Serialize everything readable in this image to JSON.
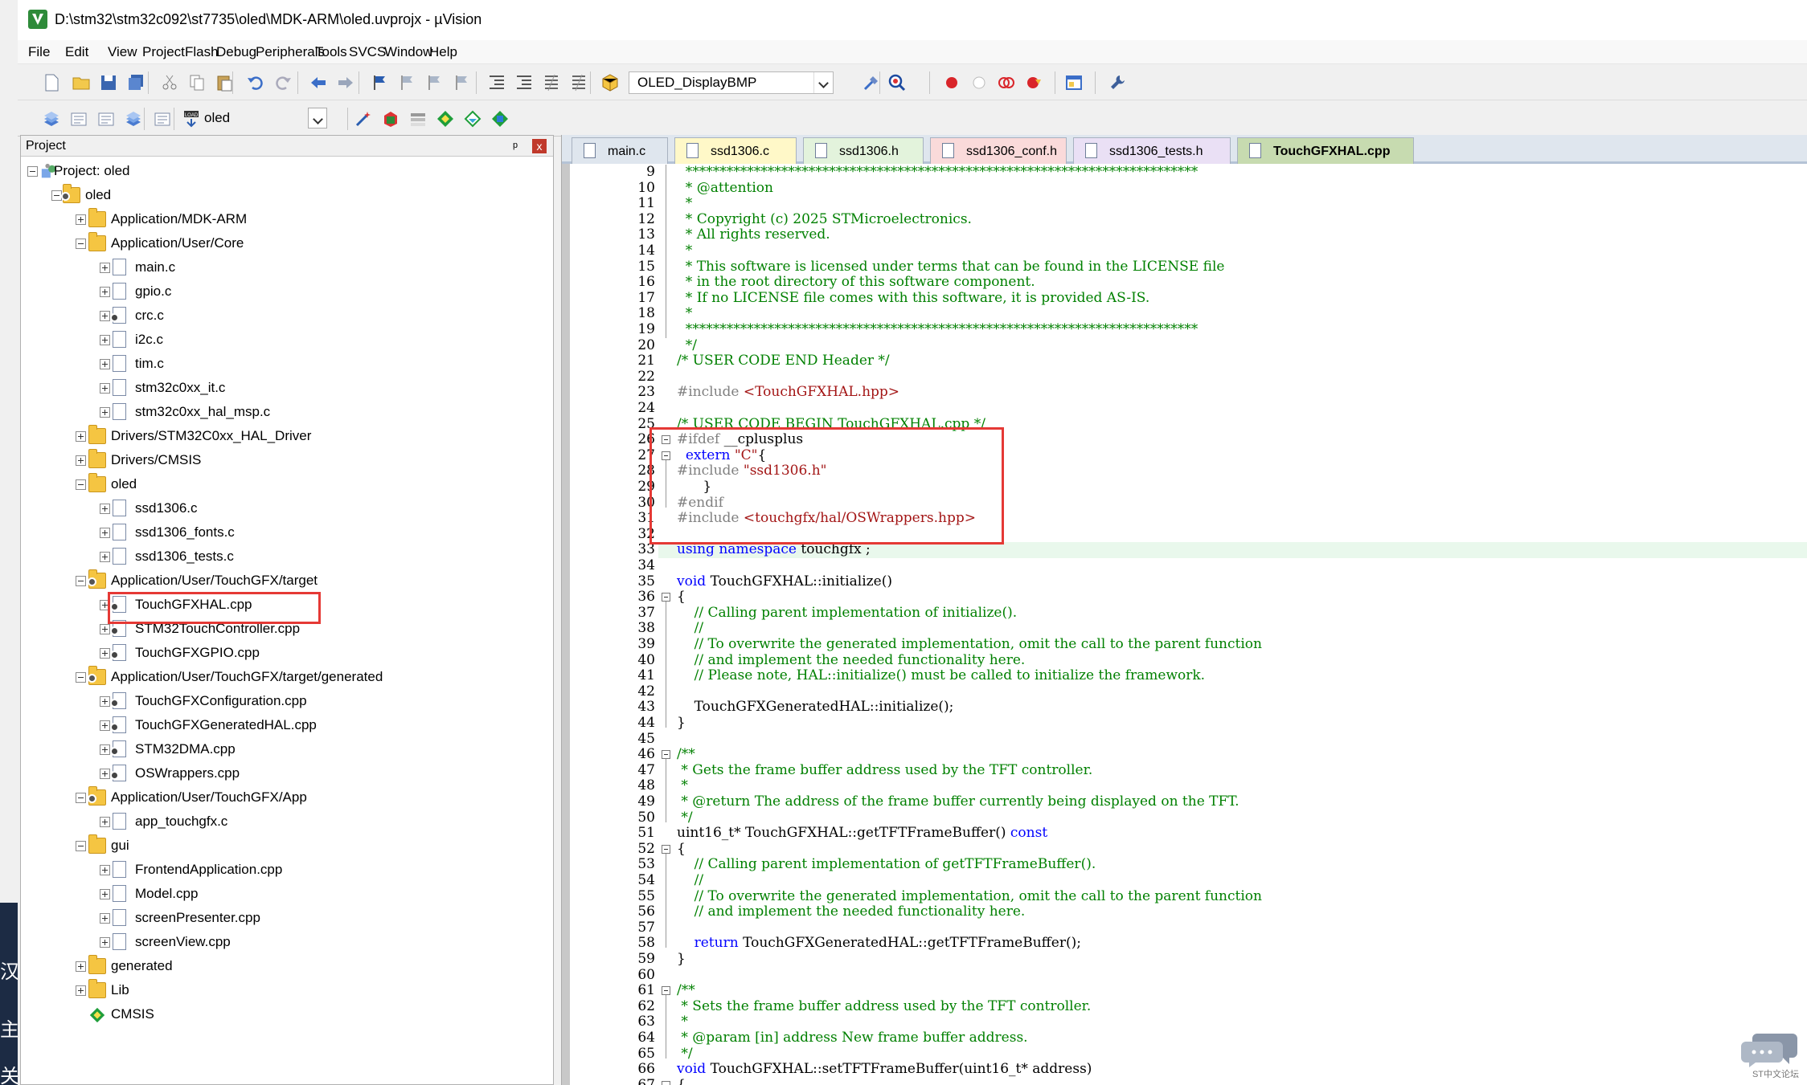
{
  "window": {
    "title": "D:\\stm32\\stm32c092\\st7735\\oled\\MDK-ARM\\oled.uvprojx - µVision"
  },
  "menu": [
    "File",
    "Edit",
    "View",
    "Project",
    "Flash",
    "Debug",
    "Peripherals",
    "Tools",
    "SVCS",
    "Window",
    "Help"
  ],
  "toolbar": {
    "target_combo": "OLED_DisplayBMP",
    "build_target": "oled"
  },
  "project": {
    "header": "Project",
    "pin": "ᵖ",
    "close": "x",
    "tree": [
      {
        "level": 0,
        "label": "Project: oled",
        "exp": "minus",
        "icon": "project"
      },
      {
        "level": 1,
        "label": "oled",
        "exp": "minus",
        "icon": "target"
      },
      {
        "level": 2,
        "label": "Application/MDK-ARM",
        "exp": "plus",
        "icon": "folder"
      },
      {
        "level": 2,
        "label": "Application/User/Core",
        "exp": "minus",
        "icon": "folder-open"
      },
      {
        "level": 3,
        "label": "main.c",
        "exp": "plus",
        "icon": "file"
      },
      {
        "level": 3,
        "label": "gpio.c",
        "exp": "plus",
        "icon": "file"
      },
      {
        "level": 3,
        "label": "crc.c",
        "exp": "plus",
        "icon": "file-gear"
      },
      {
        "level": 3,
        "label": "i2c.c",
        "exp": "plus",
        "icon": "file"
      },
      {
        "level": 3,
        "label": "tim.c",
        "exp": "plus",
        "icon": "file"
      },
      {
        "level": 3,
        "label": "stm32c0xx_it.c",
        "exp": "plus",
        "icon": "file"
      },
      {
        "level": 3,
        "label": "stm32c0xx_hal_msp.c",
        "exp": "plus",
        "icon": "file"
      },
      {
        "level": 2,
        "label": "Drivers/STM32C0xx_HAL_Driver",
        "exp": "plus",
        "icon": "folder"
      },
      {
        "level": 2,
        "label": "Drivers/CMSIS",
        "exp": "plus",
        "icon": "folder"
      },
      {
        "level": 2,
        "label": "oled",
        "exp": "minus",
        "icon": "folder-open"
      },
      {
        "level": 3,
        "label": "ssd1306.c",
        "exp": "plus",
        "icon": "file"
      },
      {
        "level": 3,
        "label": "ssd1306_fonts.c",
        "exp": "plus",
        "icon": "file"
      },
      {
        "level": 3,
        "label": "ssd1306_tests.c",
        "exp": "plus",
        "icon": "file"
      },
      {
        "level": 2,
        "label": "Application/User/TouchGFX/target",
        "exp": "minus",
        "icon": "folder-gear"
      },
      {
        "level": 3,
        "label": "TouchGFXHAL.cpp",
        "exp": "plus",
        "icon": "file-gear"
      },
      {
        "level": 3,
        "label": "STM32TouchController.cpp",
        "exp": "plus",
        "icon": "file-gear"
      },
      {
        "level": 3,
        "label": "TouchGFXGPIO.cpp",
        "exp": "plus",
        "icon": "file-gear"
      },
      {
        "level": 2,
        "label": "Application/User/TouchGFX/target/generated",
        "exp": "minus",
        "icon": "folder-gear"
      },
      {
        "level": 3,
        "label": "TouchGFXConfiguration.cpp",
        "exp": "plus",
        "icon": "file-gear"
      },
      {
        "level": 3,
        "label": "TouchGFXGeneratedHAL.cpp",
        "exp": "plus",
        "icon": "file-gear"
      },
      {
        "level": 3,
        "label": "STM32DMA.cpp",
        "exp": "plus",
        "icon": "file-gear"
      },
      {
        "level": 3,
        "label": "OSWrappers.cpp",
        "exp": "plus",
        "icon": "file-gear"
      },
      {
        "level": 2,
        "label": "Application/User/TouchGFX/App",
        "exp": "minus",
        "icon": "folder-gear"
      },
      {
        "level": 3,
        "label": "app_touchgfx.c",
        "exp": "plus",
        "icon": "file"
      },
      {
        "level": 2,
        "label": "gui",
        "exp": "minus",
        "icon": "folder-open"
      },
      {
        "level": 3,
        "label": "FrontendApplication.cpp",
        "exp": "plus",
        "icon": "file"
      },
      {
        "level": 3,
        "label": "Model.cpp",
        "exp": "plus",
        "icon": "file"
      },
      {
        "level": 3,
        "label": "screenPresenter.cpp",
        "exp": "plus",
        "icon": "file"
      },
      {
        "level": 3,
        "label": "screenView.cpp",
        "exp": "plus",
        "icon": "file"
      },
      {
        "level": 2,
        "label": "generated",
        "exp": "plus",
        "icon": "folder"
      },
      {
        "level": 2,
        "label": "Lib",
        "exp": "plus",
        "icon": "folder"
      },
      {
        "level": 2,
        "label": "CMSIS",
        "exp": "none",
        "icon": "diamond"
      }
    ]
  },
  "tabs": [
    {
      "label": "main.c",
      "color": "#dfe6ee",
      "active": false
    },
    {
      "label": "ssd1306.c",
      "color": "#fff8c8",
      "active": false
    },
    {
      "label": "ssd1306.h",
      "color": "#e3f3dc",
      "active": false
    },
    {
      "label": "ssd1306_conf.h",
      "color": "#fadada",
      "active": false
    },
    {
      "label": "ssd1306_tests.h",
      "color": "#eae0f5",
      "active": false
    },
    {
      "label": "TouchGFXHAL.cpp",
      "color": "#c7dbb0",
      "active": true
    }
  ],
  "code": [
    {
      "n": "9",
      "t": [
        [
          "cm",
          "  ***************************************************************************"
        ]
      ]
    },
    {
      "n": "10",
      "t": [
        [
          "cm",
          "  * @attention"
        ]
      ]
    },
    {
      "n": "11",
      "t": [
        [
          "cm",
          "  *"
        ]
      ]
    },
    {
      "n": "12",
      "t": [
        [
          "cm",
          "  * Copyright (c) 2025 STMicroelectronics."
        ]
      ]
    },
    {
      "n": "13",
      "t": [
        [
          "cm",
          "  * All rights reserved."
        ]
      ]
    },
    {
      "n": "14",
      "t": [
        [
          "cm",
          "  *"
        ]
      ]
    },
    {
      "n": "15",
      "t": [
        [
          "cm",
          "  * This software is licensed under terms that can be found in the LICENSE file"
        ]
      ]
    },
    {
      "n": "16",
      "t": [
        [
          "cm",
          "  * in the root directory of this software component."
        ]
      ]
    },
    {
      "n": "17",
      "t": [
        [
          "cm",
          "  * If no LICENSE file comes with this software, it is provided AS-IS."
        ]
      ]
    },
    {
      "n": "18",
      "t": [
        [
          "cm",
          "  *"
        ]
      ]
    },
    {
      "n": "19",
      "t": [
        [
          "cm",
          "  ***************************************************************************"
        ]
      ]
    },
    {
      "n": "20",
      "t": [
        [
          "cm",
          "  */"
        ]
      ]
    },
    {
      "n": "21",
      "t": [
        [
          "cm",
          "/* USER CODE END Header */"
        ]
      ]
    },
    {
      "n": "22",
      "t": []
    },
    {
      "n": "23",
      "t": [
        [
          "pp",
          "#include "
        ],
        [
          "st",
          "<TouchGFXHAL.hpp>"
        ]
      ]
    },
    {
      "n": "24",
      "t": []
    },
    {
      "n": "25",
      "t": [
        [
          "cm",
          "/* USER CODE BEGIN TouchGFXHAL.cpp */"
        ]
      ]
    },
    {
      "n": "26",
      "t": [
        [
          "pp",
          "#ifdef "
        ],
        [
          "tx",
          "__cplusplus"
        ]
      ]
    },
    {
      "n": "27",
      "t": [
        [
          "tx",
          "  "
        ],
        [
          "kw",
          "extern"
        ],
        [
          "tx",
          " "
        ],
        [
          "st",
          "\"C\""
        ],
        [
          "tx",
          "{"
        ]
      ]
    },
    {
      "n": "28",
      "t": [
        [
          "pp",
          "#include "
        ],
        [
          "st",
          "\"ssd1306.h\""
        ]
      ]
    },
    {
      "n": "29",
      "t": [
        [
          "tx",
          "      }"
        ]
      ]
    },
    {
      "n": "30",
      "t": [
        [
          "pp",
          "#endif"
        ]
      ]
    },
    {
      "n": "31",
      "t": [
        [
          "pp",
          "#include "
        ],
        [
          "st",
          "<touchgfx/hal/OSWrappers.hpp>"
        ]
      ]
    },
    {
      "n": "32",
      "t": []
    },
    {
      "n": "33",
      "t": [
        [
          "kw",
          "using"
        ],
        [
          "tx",
          " "
        ],
        [
          "kw",
          "namespace"
        ],
        [
          "tx",
          " touchgfx ;"
        ]
      ]
    },
    {
      "n": "34",
      "t": []
    },
    {
      "n": "35",
      "t": [
        [
          "kw",
          "void"
        ],
        [
          "tx",
          " TouchGFXHAL::initialize()"
        ]
      ]
    },
    {
      "n": "36",
      "t": [
        [
          "tx",
          "{"
        ]
      ]
    },
    {
      "n": "37",
      "t": [
        [
          "cm",
          "    // Calling parent implementation of initialize()."
        ]
      ]
    },
    {
      "n": "38",
      "t": [
        [
          "cm",
          "    //"
        ]
      ]
    },
    {
      "n": "39",
      "t": [
        [
          "cm",
          "    // To overwrite the generated implementation, omit the call to the parent function"
        ]
      ]
    },
    {
      "n": "40",
      "t": [
        [
          "cm",
          "    // and implement the needed functionality here."
        ]
      ]
    },
    {
      "n": "41",
      "t": [
        [
          "cm",
          "    // Please note, HAL::initialize() must be called to initialize the framework."
        ]
      ]
    },
    {
      "n": "42",
      "t": []
    },
    {
      "n": "43",
      "t": [
        [
          "tx",
          "    TouchGFXGeneratedHAL::initialize();"
        ]
      ]
    },
    {
      "n": "44",
      "t": [
        [
          "tx",
          "}"
        ]
      ]
    },
    {
      "n": "45",
      "t": []
    },
    {
      "n": "46",
      "t": [
        [
          "cm",
          "/**"
        ]
      ]
    },
    {
      "n": "47",
      "t": [
        [
          "cm",
          " * Gets the frame buffer address used by the TFT controller."
        ]
      ]
    },
    {
      "n": "48",
      "t": [
        [
          "cm",
          " *"
        ]
      ]
    },
    {
      "n": "49",
      "t": [
        [
          "cm",
          " * @return The address of the frame buffer currently being displayed on the TFT."
        ]
      ]
    },
    {
      "n": "50",
      "t": [
        [
          "cm",
          " */"
        ]
      ]
    },
    {
      "n": "51",
      "t": [
        [
          "tx",
          "uint16_t* TouchGFXHAL::getTFTFrameBuffer() "
        ],
        [
          "kw",
          "const"
        ]
      ]
    },
    {
      "n": "52",
      "t": [
        [
          "tx",
          "{"
        ]
      ]
    },
    {
      "n": "53",
      "t": [
        [
          "cm",
          "    // Calling parent implementation of getTFTFrameBuffer()."
        ]
      ]
    },
    {
      "n": "54",
      "t": [
        [
          "cm",
          "    //"
        ]
      ]
    },
    {
      "n": "55",
      "t": [
        [
          "cm",
          "    // To overwrite the generated implementation, omit the call to the parent function"
        ]
      ]
    },
    {
      "n": "56",
      "t": [
        [
          "cm",
          "    // and implement the needed functionality here."
        ]
      ]
    },
    {
      "n": "57",
      "t": []
    },
    {
      "n": "58",
      "t": [
        [
          "kw",
          "    return"
        ],
        [
          "tx",
          " TouchGFXGeneratedHAL::getTFTFrameBuffer();"
        ]
      ]
    },
    {
      "n": "59",
      "t": [
        [
          "tx",
          "}"
        ]
      ]
    },
    {
      "n": "60",
      "t": []
    },
    {
      "n": "61",
      "t": [
        [
          "cm",
          "/**"
        ]
      ]
    },
    {
      "n": "62",
      "t": [
        [
          "cm",
          " * Sets the frame buffer address used by the TFT controller."
        ]
      ]
    },
    {
      "n": "63",
      "t": [
        [
          "cm",
          " *"
        ]
      ]
    },
    {
      "n": "64",
      "t": [
        [
          "cm",
          " * @param [in] address New frame buffer address."
        ]
      ]
    },
    {
      "n": "65",
      "t": [
        [
          "cm",
          " */"
        ]
      ]
    },
    {
      "n": "66",
      "t": [
        [
          "kw",
          "void"
        ],
        [
          "tx",
          " TouchGFXHAL::setTFTFrameBuffer(uint16_t* address)"
        ]
      ]
    },
    {
      "n": "67",
      "t": [
        [
          "tx",
          "{"
        ]
      ]
    }
  ],
  "desktop_chars": [
    "汉",
    "主",
    "关系"
  ],
  "forum": {
    "label": "ST中文论坛"
  }
}
